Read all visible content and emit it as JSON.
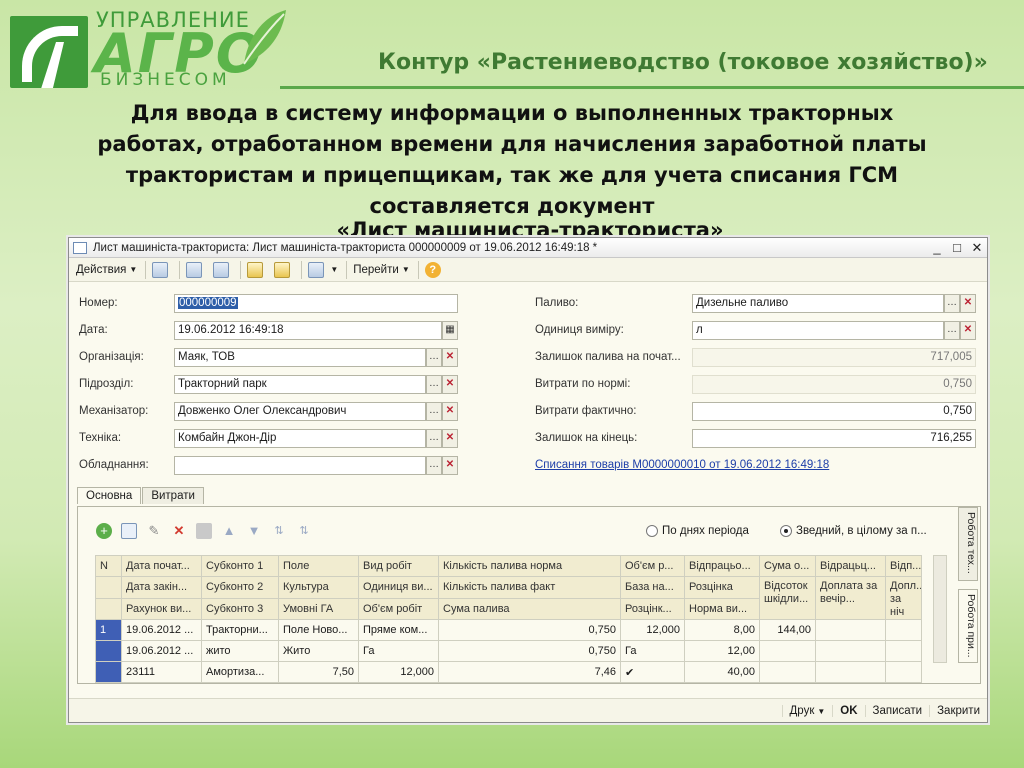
{
  "slide": {
    "logo_top": "УПРАВЛЕНИЕ",
    "logo_main": "АГРО",
    "logo_bottom": "БИЗНЕСОМ",
    "title": "Контур «Растениеводство (токовое хозяйство)»",
    "intro_line1": "Для ввода в систему информации о выполненных тракторных",
    "intro_line2": "работах,  отработанном времени для начисления заработной платы",
    "intro_line3": "трактористам и прицепщикам, так же для учета списания ГСМ",
    "intro_line4": "составляется документ",
    "doc_name": "«Лист машиниста-тракториста»"
  },
  "window": {
    "title": "Лист машиніста-тракториста: Лист машиніста-тракториста 000000009 от 19.06.2012 16:49:18 *",
    "controls": [
      "_",
      "□",
      "✕"
    ]
  },
  "toolbar": {
    "actions": "Действия",
    "goto": "Перейти"
  },
  "form": {
    "left": [
      {
        "label": "Номер:",
        "value": "000000009"
      },
      {
        "label": "Дата:",
        "value": "19.06.2012 16:49:18"
      },
      {
        "label": "Організація:",
        "value": "Маяк, ТОВ"
      },
      {
        "label": "Підрозділ:",
        "value": "Тракторний парк"
      },
      {
        "label": "Механізатор:",
        "value": "Довженко  Олег Олександрович"
      },
      {
        "label": "Техніка:",
        "value": "Комбайн Джон-Дір"
      },
      {
        "label": "Обладнання:",
        "value": ""
      }
    ],
    "right": [
      {
        "label": "Паливо:",
        "value": "Дизельне паливо"
      },
      {
        "label": "Одиниця виміру:",
        "value": "л"
      },
      {
        "label": "Залишок палива на почат...",
        "value": "717,005"
      },
      {
        "label": "Витрати по нормі:",
        "value": "0,750"
      },
      {
        "label": "Витрати фактично:",
        "value": "0,750"
      },
      {
        "label": "Залишок на кінець:",
        "value": "716,255"
      }
    ],
    "link": "Списання товарів М0000000010 от 19.06.2012 16:49:18"
  },
  "tabs": [
    "Основна",
    "Витрати"
  ],
  "panel": {
    "radio1": "По днях періода",
    "radio2": "Зведний, в цілому за п...",
    "vtab1": "Робота тех...",
    "vtab2": "Робота при..."
  },
  "grid": {
    "header_rows": [
      [
        "N",
        "Дата почат...",
        "Субконто 1",
        "Поле",
        "Вид робіт",
        "Кількість палива норма",
        "Об'єм р...",
        "Відпрацьо...",
        "Сума о...",
        "Відрацьц...",
        "Відп..."
      ],
      [
        "",
        "Дата закін...",
        "Субконто 2",
        "Культура",
        "Одиниця ви...",
        "Кількість палива факт",
        "База на...",
        "Розцінка",
        "Відсоток шкідли...",
        "Доплата за вечір...",
        "Допл... за ніч"
      ],
      [
        "",
        "Рахунок ви...",
        "Субконто 3",
        "Умовні ГА",
        "Об'єм робіт",
        "Сума палива",
        "Розцінк...",
        "Норма ви...",
        "",
        "",
        ""
      ]
    ],
    "data_rows": [
      [
        "1",
        "19.06.2012 ...",
        "Тракторни...",
        "Поле Ново...",
        "Пряме ком...",
        "0,750",
        "12,000",
        "8,00",
        "144,00",
        "",
        ""
      ],
      [
        "",
        "19.06.2012 ...",
        "жито",
        "Жито",
        "Га",
        "0,750",
        "Га",
        "12,00",
        "",
        "",
        ""
      ],
      [
        "",
        "23111",
        "Амортиза...",
        "7,50",
        "12,000",
        "7,46",
        "✔",
        "40,00",
        "",
        "",
        ""
      ]
    ]
  },
  "bottom": {
    "print": "Друк",
    "ok": "OK",
    "save": "Записати",
    "close": "Закрити"
  },
  "colors": {
    "accent_green": "#3f9b3a",
    "selection": "#3f5fb5"
  }
}
